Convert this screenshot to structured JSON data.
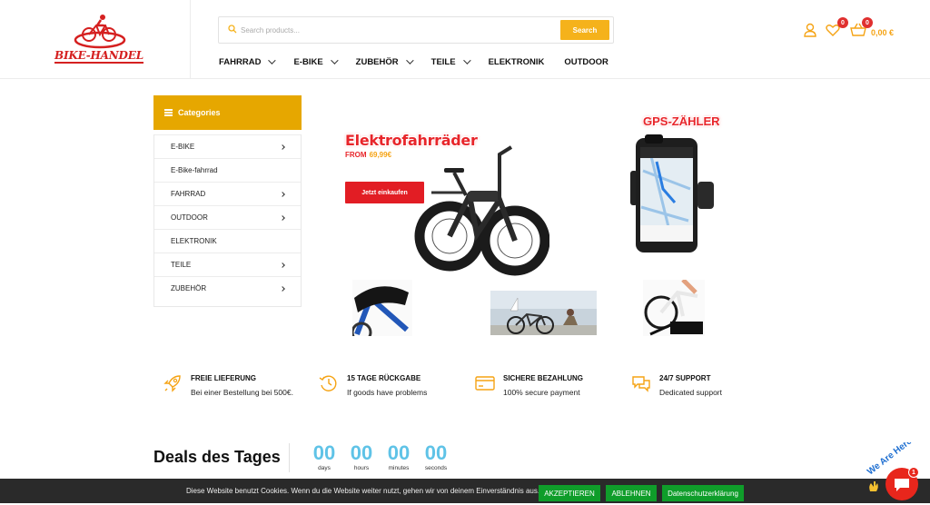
{
  "brand": {
    "logo_text": "BIKE-HANDEL"
  },
  "search": {
    "placeholder": "Search products...",
    "button": "Search"
  },
  "nav": [
    "FAHRRAD",
    "E-BIKE",
    "ZUBEHÖR",
    "TEILE",
    "ELEKTRONIK",
    "OUTDOOR"
  ],
  "header": {
    "wishlist_count": "0",
    "cart_count": "0",
    "cart_total": "0,00 €"
  },
  "categories": {
    "title": "Categories",
    "items": [
      "E-BIKE",
      "E-Bike-fahrrad",
      "FAHRRAD",
      "OUTDOOR",
      "ELEKTRONIK",
      "TEILE",
      "ZUBEHÖR"
    ]
  },
  "banner": {
    "title": "Elektrofahrräder",
    "from_label": "FROM",
    "price": "69,99€",
    "button": "Jetzt einkaufen",
    "gps_title": "GPS-ZÄHLER"
  },
  "features": [
    {
      "title": "FREIE LIEFERUNG",
      "text": "Bei einer Bestellung bei 500€."
    },
    {
      "title": "15 TAGE RÜCKGABE",
      "text": "If goods have problems"
    },
    {
      "title": "SICHERE BEZAHLUNG",
      "text": "100% secure payment"
    },
    {
      "title": "24/7 SUPPORT",
      "text": "Dedicated support"
    }
  ],
  "deals": {
    "title": "Deals des Tages",
    "countdown": [
      {
        "value": "00",
        "unit": "days"
      },
      {
        "value": "00",
        "unit": "hours"
      },
      {
        "value": "00",
        "unit": "minutes"
      },
      {
        "value": "00",
        "unit": "seconds"
      }
    ]
  },
  "cookie": {
    "text": "Diese Website benutzt Cookies. Wenn du die Website weiter nutzt, gehen wir von deinem Einverständnis aus.",
    "accept": "AKZEPTIEREN",
    "reject": "ABLEHNEN",
    "privacy": "Datenschutzerklärung"
  },
  "chat": {
    "badge": "1",
    "label": "We Are Here!"
  },
  "colors": {
    "accent": "#f5b21b",
    "category_header": "#e6a700",
    "red": "#e21d24",
    "countdown": "#5fc3e7",
    "cookie_button": "#0f9d2a"
  }
}
